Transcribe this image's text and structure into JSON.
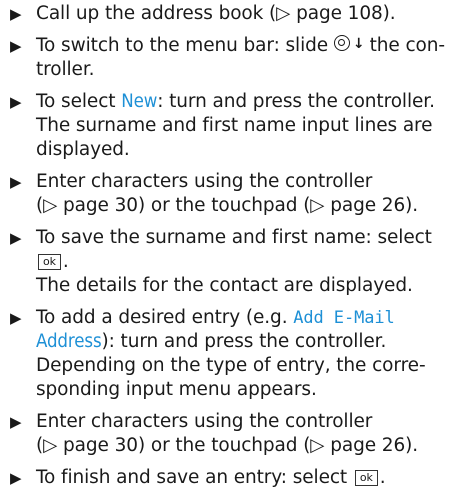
{
  "icons": {
    "bullet": "black-right-pointing-triangle",
    "page_ref": "white-right-pointing-triangle",
    "controller": "controller-slide-down-icon",
    "ok_key": "ok-key-icon"
  },
  "colors": {
    "text": "#1a1a1a",
    "highlight": "#1e90d6"
  },
  "bullet_glyph": "▶",
  "ok_label": "ok",
  "steps": [
    {
      "l1": "Call up the address book (▷ page 108)."
    },
    {
      "l1a": "To switch to the menu bar: slide",
      "l1b": "the con-",
      "l2": "troller."
    },
    {
      "l1a": "To select ",
      "hl": "New",
      "l1b": ": turn and press the controller.",
      "l2": "The surname and first name input lines are",
      "l3": "displayed."
    },
    {
      "l1": "Enter characters using the controller",
      "l2": "(▷ page 30) or the touchpad (▷ page 26)."
    },
    {
      "l1": "To save the surname and first name: select",
      "l3": "The details for the contact are displayed."
    },
    {
      "l1a": "To add a desired entry (e.g. ",
      "hl1": "Add E-Mail",
      "hl2": "Address",
      "l2b": "): turn and press the controller.",
      "l3": "Depending on the type of entry, the corre-",
      "l4": "sponding input menu appears."
    },
    {
      "l1": "Enter characters using the controller",
      "l2": "(▷ page 30) or the touchpad (▷ page 26)."
    },
    {
      "l1": "To finish and save an entry: select"
    }
  ]
}
